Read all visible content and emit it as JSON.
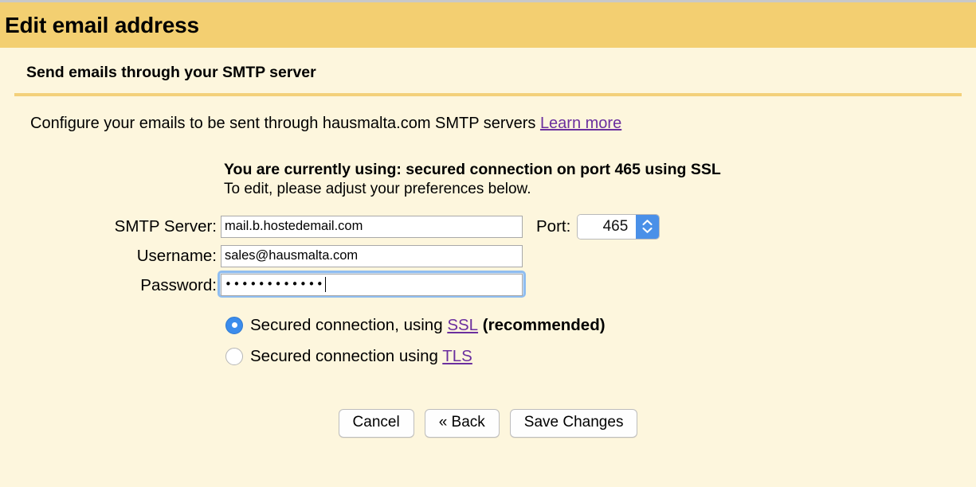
{
  "window": {
    "title": "Edit email address",
    "title_bar_color": "#f3cf71",
    "background_color": "#fdf6dd"
  },
  "section": {
    "heading": "Send emails through your SMTP server",
    "divider_color": "#f3d07a",
    "lead_text": "Configure your emails to be sent through hausmalta.com SMTP servers",
    "learn_more_label": "Learn more",
    "link_color": "#6b2f9e"
  },
  "status": {
    "current": "You are currently using: secured connection on port 465 using SSL",
    "hint": "To edit, please adjust your preferences below."
  },
  "form": {
    "smtp_server": {
      "label": "SMTP Server:",
      "value": "mail.b.hostedemail.com",
      "placeholder": ""
    },
    "port": {
      "label": "Port:",
      "value": "465"
    },
    "username": {
      "label": "Username:",
      "value": "sales@hausmalta.com",
      "placeholder": ""
    },
    "password": {
      "label": "Password:",
      "value": "••••••••••••",
      "placeholder": "",
      "masked_char_count": 12,
      "focused": true,
      "focus_ring_color": "#8fbdf0"
    }
  },
  "security_options": {
    "selected": "ssl",
    "accent_color": "#3b8cec",
    "ssl": {
      "text_before": "Secured connection, using ",
      "link_label": "SSL",
      "text_after": " (recommended)"
    },
    "tls": {
      "text_before": "Secured connection using ",
      "link_label": "TLS",
      "text_after": ""
    }
  },
  "buttons": {
    "cancel": "Cancel",
    "back": "« Back",
    "save": "Save Changes"
  }
}
